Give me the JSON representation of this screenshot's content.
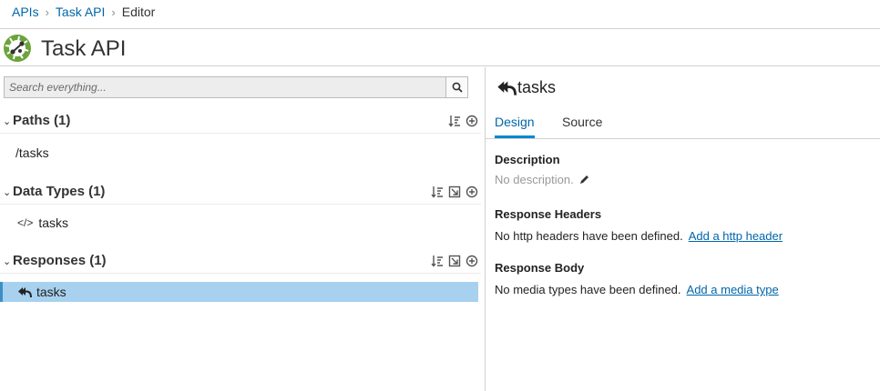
{
  "breadcrumb": {
    "items": [
      "APIs",
      "Task API"
    ],
    "current": "Editor"
  },
  "header": {
    "title": "Task API"
  },
  "search": {
    "placeholder": "Search everything..."
  },
  "sections": {
    "paths": {
      "title": "Paths (1)",
      "items": [
        "/tasks"
      ]
    },
    "data_types": {
      "title": "Data Types (1)",
      "items": [
        "tasks"
      ]
    },
    "responses": {
      "title": "Responses (1)",
      "items": [
        "tasks"
      ]
    }
  },
  "detail": {
    "title": "tasks",
    "tabs": [
      "Design",
      "Source"
    ],
    "active_tab": "Design",
    "description_label": "Description",
    "description_value": "No description.",
    "response_headers_label": "Response Headers",
    "response_headers_empty": "No http headers have been defined.",
    "response_headers_link": "Add a http header",
    "response_body_label": "Response Body",
    "response_body_empty": "No media types have been defined.",
    "response_body_link": "Add a media type"
  },
  "colors": {
    "link": "#0066aa",
    "selected_bg": "#a7d1ee",
    "active_tab": "#0088ce",
    "logo_green": "#6ba43a"
  }
}
